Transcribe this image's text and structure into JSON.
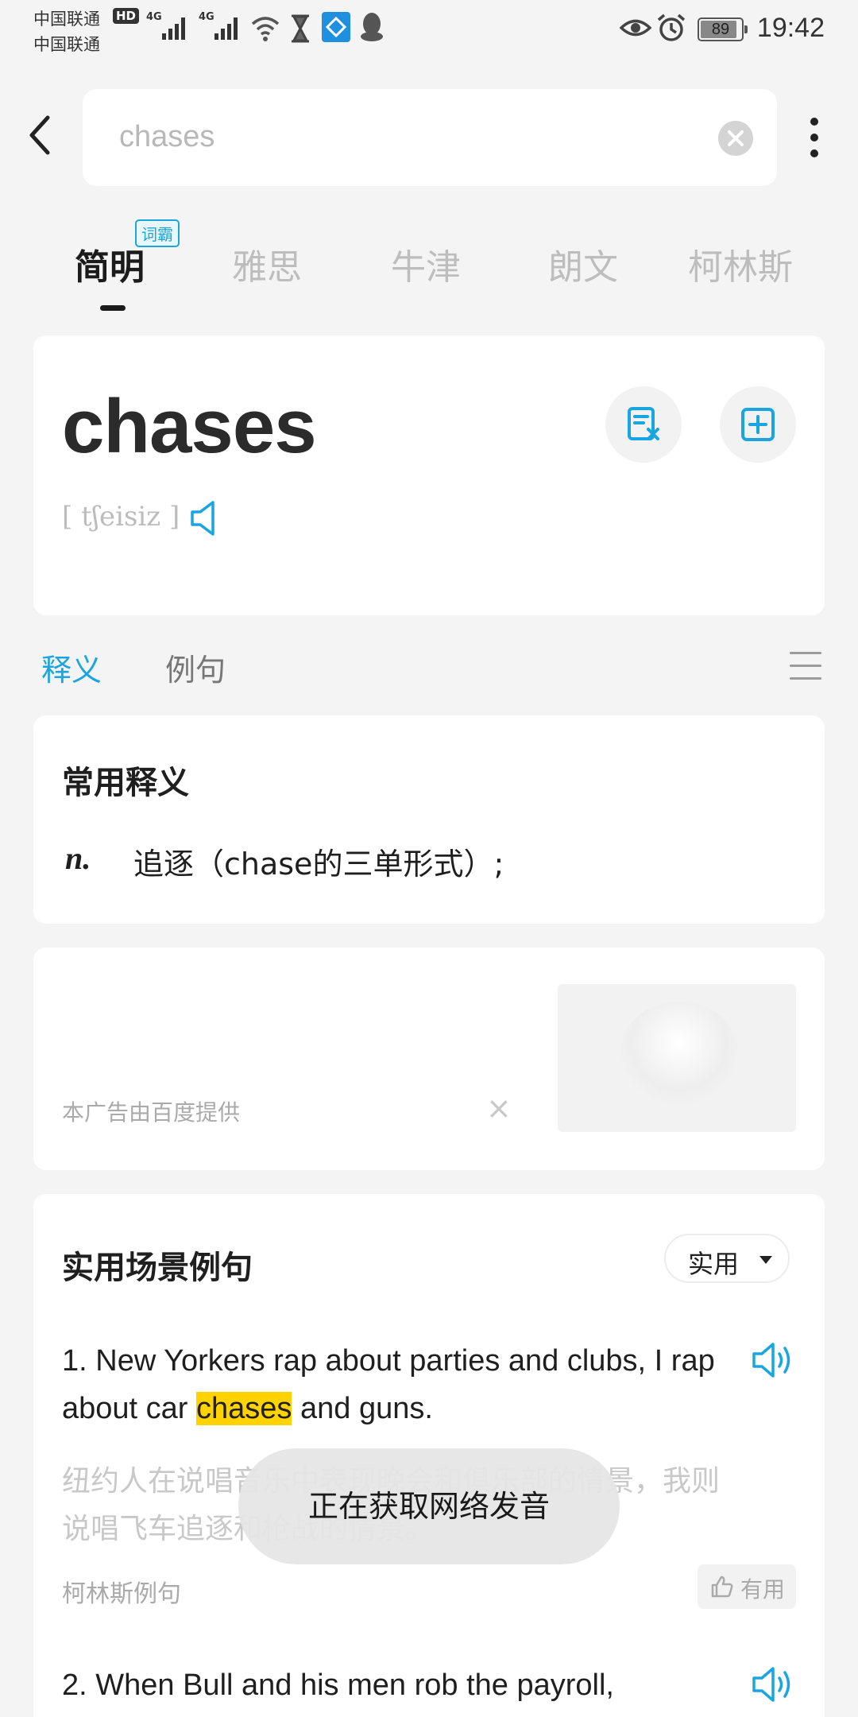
{
  "status_bar": {
    "carrier_1": "中国联通",
    "carrier_2": "中国联通",
    "hd": "HD",
    "net_1": "4G",
    "net_2": "4G",
    "battery": "89",
    "battery_level": 0.89,
    "time": "19:42"
  },
  "search": {
    "placeholder": "chases",
    "value": ""
  },
  "dict_tabs": {
    "badge": "词霸",
    "items": [
      {
        "label": "简明",
        "active": true
      },
      {
        "label": "雅思"
      },
      {
        "label": "牛津"
      },
      {
        "label": "朗文"
      },
      {
        "label": "柯林斯"
      }
    ]
  },
  "word_card": {
    "word": "chases",
    "phonetic": "[ tʃeisiz ]"
  },
  "section_tabs": {
    "definitions": "释义",
    "examples": "例句"
  },
  "common_definitions": {
    "title": "常用释义",
    "pos": "n.",
    "meaning": "追逐（chase的三单形式）;"
  },
  "ad": {
    "label": "本广告由百度提供",
    "close": "×"
  },
  "examples": {
    "title": "实用场景例句",
    "filter": "实用",
    "items": [
      {
        "number": "1.",
        "en_before": "New Yorkers rap about parties and clubs, I rap about car",
        "en_highlight": "chases",
        "en_after": "and guns.",
        "cn": "纽约人在说唱音乐中表现晚会和俱乐部的情景，我则说唱飞车追逐和枪战的情景。",
        "source": "柯林斯例句",
        "useful": "有用"
      },
      {
        "number": "2.",
        "en_before": "When Bull and his men rob the payroll,",
        "en_highlight": "",
        "en_after": ""
      }
    ]
  },
  "toast": {
    "text": "正在获取网络发音"
  },
  "colors": {
    "accent": "#19a5e0",
    "highlight": "#ffd200",
    "background": "#f4f4f4"
  }
}
